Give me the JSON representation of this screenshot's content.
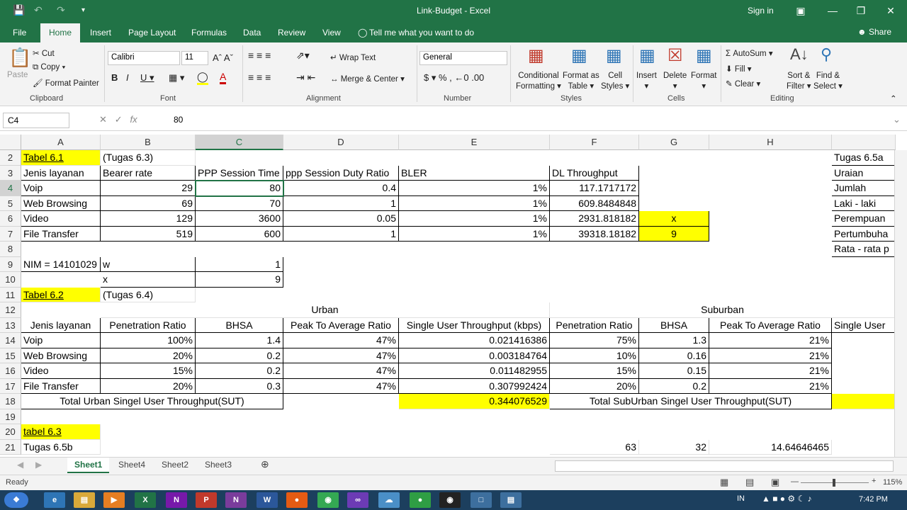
{
  "window": {
    "title": "Link-Budget  -  Excel",
    "sign_in": "Sign in"
  },
  "tabs": [
    {
      "label": "File",
      "active": false
    },
    {
      "label": "Home",
      "active": true
    },
    {
      "label": "Insert",
      "active": false
    },
    {
      "label": "Page Layout",
      "active": false
    },
    {
      "label": "Formulas",
      "active": false
    },
    {
      "label": "Data",
      "active": false
    },
    {
      "label": "Review",
      "active": false
    },
    {
      "label": "View",
      "active": false
    }
  ],
  "tell_me": "Tell me what you want to do",
  "share": "Share",
  "ribbon": {
    "clipboard": {
      "paste": "Paste",
      "cut": "Cut",
      "copy": "Copy",
      "format_painter": "Format Painter",
      "label": "Clipboard"
    },
    "font": {
      "name": "Calibri",
      "size": "11",
      "label": "Font"
    },
    "alignment": {
      "wrap": "Wrap Text",
      "merge": "Merge & Center",
      "label": "Alignment"
    },
    "number": {
      "format": "General",
      "label": "Number"
    },
    "styles": {
      "cond1": "Conditional",
      "cond2": "Formatting",
      "fmt1": "Format as",
      "fmt2": "Table",
      "cell1": "Cell",
      "cell2": "Styles",
      "label": "Styles"
    },
    "cells": {
      "insert": "Insert",
      "delete": "Delete",
      "format": "Format",
      "label": "Cells"
    },
    "editing": {
      "autosum": "AutoSum",
      "fill": "Fill",
      "clear": "Clear",
      "sort1": "Sort &",
      "sort2": "Filter",
      "find1": "Find &",
      "find2": "Select",
      "label": "Editing"
    }
  },
  "formula": {
    "name_box": "C4",
    "value": "80"
  },
  "columns": [
    "A",
    "B",
    "C",
    "D",
    "E",
    "F",
    "G",
    "H",
    ""
  ],
  "rows": [
    "2",
    "3",
    "4",
    "5",
    "6",
    "7",
    "8",
    "9",
    "10",
    "11",
    "12",
    "13",
    "14",
    "15",
    "16",
    "17",
    "18",
    "19",
    "20",
    "21"
  ],
  "cells": {
    "r2": {
      "a": "Tabel 6.1",
      "b": "(Tugas 6.3)",
      "i": "Tugas 6.5a"
    },
    "r3": {
      "a": "Jenis layanan",
      "b": "Bearer rate",
      "c": "PPP Session Time",
      "d": "ppp Session Duty Ratio",
      "e": "BLER",
      "f": "DL Throughput",
      "i": "Uraian"
    },
    "r4": {
      "a": "Voip",
      "b": "29",
      "c": "80",
      "d": "0.4",
      "e": "1%",
      "f": "117.1717172",
      "i": "Jumlah"
    },
    "r5": {
      "a": "Web Browsing",
      "b": "69",
      "c": "70",
      "d": "1",
      "e": "1%",
      "f": "609.8484848",
      "i": "Laki - laki"
    },
    "r6": {
      "a": "Video",
      "b": "129",
      "c": "3600",
      "d": "0.05",
      "e": "1%",
      "f": "2931.818182",
      "g": "x",
      "i": "Perempuan"
    },
    "r7": {
      "a": "File Transfer",
      "b": "519",
      "c": "600",
      "d": "1",
      "e": "1%",
      "f": "39318.18182",
      "g": "9",
      "i": "Pertumbuha"
    },
    "r8": {
      "i": "Rata - rata p"
    },
    "r9": {
      "a": "NIM = 14101029",
      "b": "w",
      "c": "1"
    },
    "r10": {
      "b": "x",
      "c": "9"
    },
    "r11": {
      "a": "Tabel 6.2",
      "b": "(Tugas 6.4)"
    },
    "r12": {
      "urban": "Urban",
      "suburban": "Suburban"
    },
    "r13": {
      "a": "Jenis layanan",
      "b": "Penetration Ratio",
      "c": "BHSA",
      "d": "Peak To Average Ratio",
      "e": "Single User Throughput (kbps)",
      "f": "Penetration Ratio",
      "g": "BHSA",
      "h": "Peak To Average Ratio",
      "i": "Single User"
    },
    "r14": {
      "a": "Voip",
      "b": "100%",
      "c": "1.4",
      "d": "47%",
      "e": "0.021416386",
      "f": "75%",
      "g": "1.3",
      "h": "21%"
    },
    "r15": {
      "a": "Web Browsing",
      "b": "20%",
      "c": "0.2",
      "d": "47%",
      "e": "0.003184764",
      "f": "10%",
      "g": "0.16",
      "h": "21%"
    },
    "r16": {
      "a": "Video",
      "b": "15%",
      "c": "0.2",
      "d": "47%",
      "e": "0.011482955",
      "f": "15%",
      "g": "0.15",
      "h": "21%"
    },
    "r17": {
      "a": "File Transfer",
      "b": "20%",
      "c": "0.3",
      "d": "47%",
      "e": "0.307992424",
      "f": "20%",
      "g": "0.2",
      "h": "21%"
    },
    "r18": {
      "urban_total": "Total Urban Singel User Throughput(SUT)",
      "e": "0.344076529",
      "sub_total": "Total SubUrban Singel User Throughput(SUT)"
    },
    "r20": {
      "a": "tabel 6.3"
    },
    "r21": {
      "a": "Tugas 6.5b",
      "f": "63",
      "g": "32",
      "h": "14.64646465"
    }
  },
  "sheets": [
    "Sheet1",
    "Sheet4",
    "Sheet2",
    "Sheet3"
  ],
  "status": {
    "ready": "Ready",
    "zoom": "115%"
  },
  "taskbar": {
    "lang": "IN",
    "time": "7:42 PM"
  },
  "colors": {
    "excel_green": "#217346",
    "highlight": "#ffff00"
  }
}
